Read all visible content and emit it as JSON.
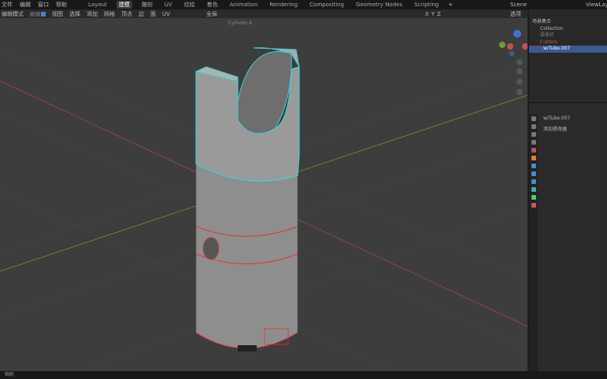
{
  "menu": [
    "文件",
    "编辑",
    "窗口",
    "帮助"
  ],
  "workspaces": [
    {
      "label": "Layout"
    },
    {
      "label": "建模",
      "active": true
    },
    {
      "label": "雕刻"
    },
    {
      "label": "UV"
    },
    {
      "label": "纹绘"
    },
    {
      "label": "着色"
    },
    {
      "label": "Animation"
    },
    {
      "label": "Rendering"
    },
    {
      "label": "Compositing"
    },
    {
      "label": "Geometry Nodes"
    },
    {
      "label": "Scripting"
    }
  ],
  "add_workspace": "+",
  "scene": "Scene",
  "view_layer": "ViewLayer",
  "header": {
    "mode": "编辑模式",
    "menus": [
      "视图",
      "选择",
      "添加",
      "网格",
      "顶点",
      "边",
      "面",
      "UV"
    ],
    "transform": "全局",
    "axes": [
      "X",
      "Y",
      "Z"
    ],
    "options": "选项"
  },
  "viewport": {
    "object_label": "Cylinder.8",
    "colors": {
      "x_axis": "#b24040",
      "y_axis": "#8aa02a",
      "selection": "#3fd1d6",
      "seam": "#e0342a"
    }
  },
  "outliner": {
    "root": "场景集合",
    "items": [
      "Collection",
      "摄像机",
      "Cutters",
      "w/Tube.007"
    ],
    "selected": "w/Tube.007"
  },
  "properties": {
    "object": "w/Tube.007",
    "add_modifier": "添加修改器"
  },
  "status": "相机"
}
